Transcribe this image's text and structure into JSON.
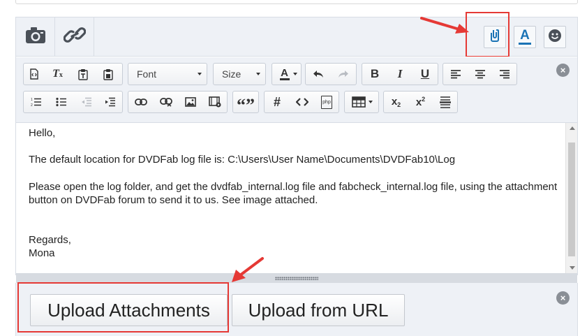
{
  "upper_toolbar": {
    "camera_icon": "camera-icon",
    "link_icon": "link-icon",
    "attach_icon": "attach-icon",
    "font_color_icon": "font-color-icon",
    "smiley_icon": "smiley-icon",
    "font_color_letter": "A"
  },
  "toolbar": {
    "font_label": "Font",
    "size_label": "Size",
    "bold": "B",
    "italic": "I",
    "underline": "U",
    "font_color_letter": "A",
    "quote": "“”",
    "hash": "#",
    "code": "<>",
    "php_label": "php"
  },
  "editor": {
    "lines": [
      "Hello,",
      "The default location for DVDFab log file is: C:\\Users\\User Name\\Documents\\DVDFab10\\Log",
      "Please open the log folder, and get the dvdfab_internal.log file and fabcheck_internal.log file, using the attachment button on DVDFab forum to send it to us. See image attached.",
      "Regards,",
      "Mona"
    ]
  },
  "attachments": {
    "upload_attachments_label": "Upload Attachments",
    "upload_url_label": "Upload from URL"
  },
  "colors": {
    "highlight": "#e53935",
    "toolbar_bg": "#eef1f6",
    "accent_blue": "#1a73b5"
  }
}
